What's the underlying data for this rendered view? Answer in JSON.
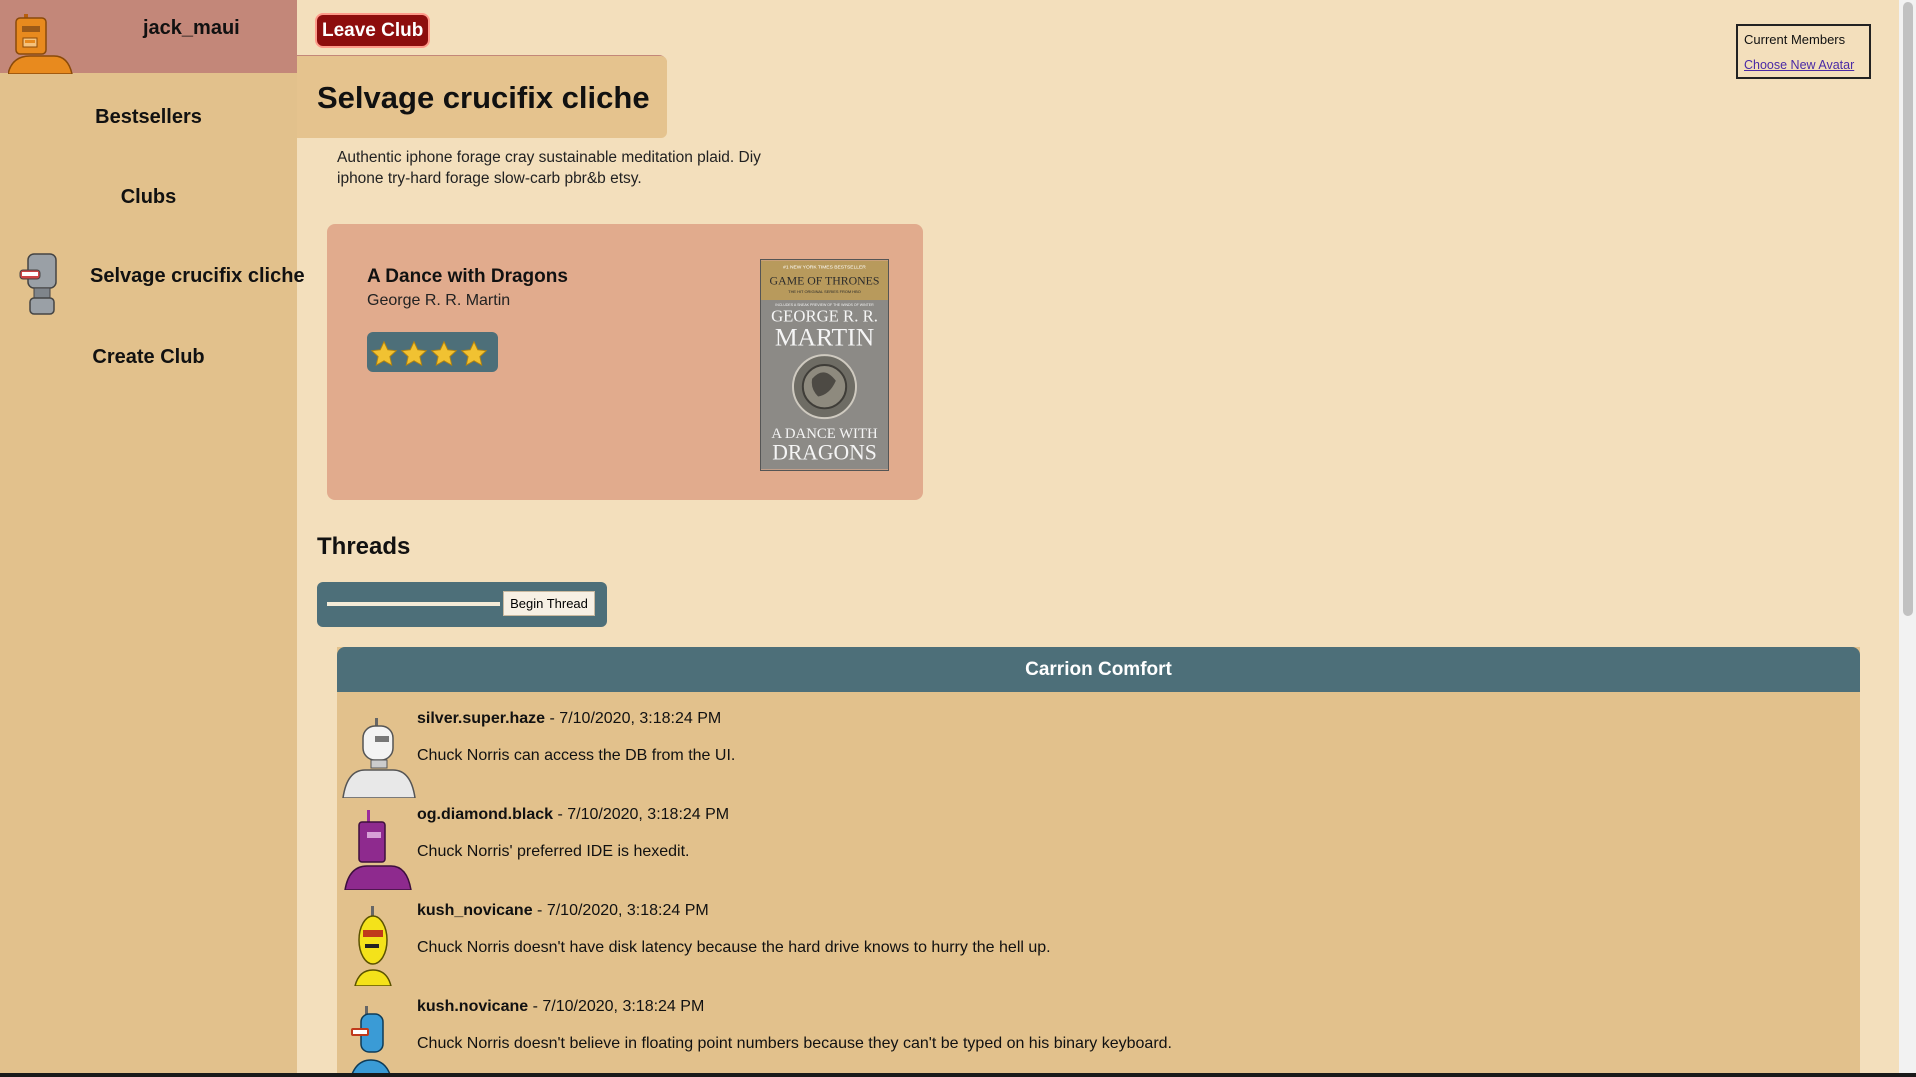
{
  "user": {
    "name": "jack_maui"
  },
  "sidebar": {
    "items": [
      {
        "label": "Bestsellers"
      },
      {
        "label": "Clubs"
      },
      {
        "label": "Selvage crucifix cliche"
      },
      {
        "label": "Create Club"
      }
    ]
  },
  "header": {
    "leave_label": "Leave Club"
  },
  "club": {
    "title": "Selvage crucifix cliche",
    "description": "Authentic iphone forage cray sustainable meditation plaid. Diy iphone try-hard forage slow-carb pbr&b etsy."
  },
  "book": {
    "title": "A Dance with Dragons",
    "author": "George R. R. Martin",
    "rating": 4,
    "rating_max": 4,
    "cover": {
      "banner": "#1 NEW YORK TIMES BESTSELLER",
      "series": "GAME OF THRONES",
      "series_sub": "THE HIT ORIGINAL SERIES FROM HBO",
      "sub_note": "INCLUDES A SNEAK PREVIEW OF THE WINDS OF WINTER",
      "author_line1": "GEORGE R. R.",
      "author_line2": "MARTIN",
      "title_line1": "A DANCE WITH",
      "title_line2": "DRAGONS"
    }
  },
  "threads": {
    "heading": "Threads",
    "begin_label": "Begin Thread",
    "list": [
      {
        "title": "Carrion Comfort",
        "posts": [
          {
            "user": "silver.super.haze",
            "time": " - 7/10/2020, 3:18:24 PM",
            "text": "Chuck Norris can access the DB from the UI.",
            "avatar": "white-robot"
          },
          {
            "user": "og.diamond.black",
            "time": " - 7/10/2020, 3:18:24 PM",
            "text": "Chuck Norris' preferred IDE is hexedit.",
            "avatar": "purple-robot"
          },
          {
            "user": "kush_novicane",
            "time": " - 7/10/2020, 3:18:24 PM",
            "text": "Chuck Norris doesn't have disk latency because the hard drive knows to hurry the hell up.",
            "avatar": "yellow-robot"
          },
          {
            "user": "kush.novicane",
            "time": " - 7/10/2020, 3:18:24 PM",
            "text": "Chuck Norris doesn't believe in floating point numbers because they can't be typed on his binary keyboard.",
            "avatar": "blue-robot"
          }
        ]
      }
    ]
  },
  "members": {
    "title": "Current Members",
    "avatar_link": "Choose New Avatar"
  },
  "colors": {
    "background": "#f3dfbc",
    "sidebar": "#e2c18c",
    "user_bar": "#c38779",
    "accent_slate": "#4d6f79",
    "leave_red": "#8d0d0d",
    "card": "#e1ab8d",
    "star": "#f1c232"
  }
}
